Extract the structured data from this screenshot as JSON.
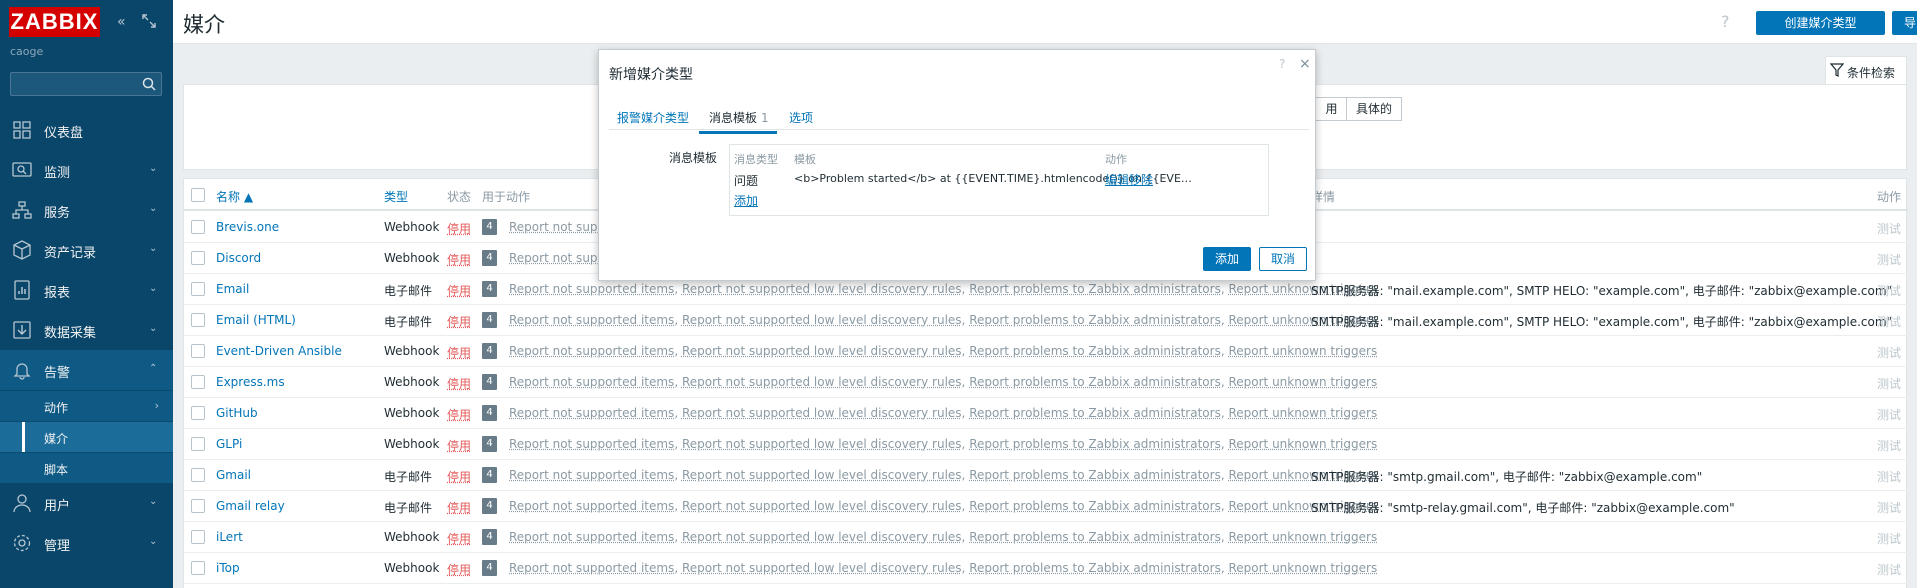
{
  "sidebar": {
    "logo": "ZABBIX",
    "server_name": "caoge",
    "search": {
      "value": "",
      "placeholder": ""
    },
    "menu": [
      {
        "label": "仪表盘",
        "icon": "dashboard-icon"
      },
      {
        "label": "监测",
        "icon": "monitoring-icon"
      },
      {
        "label": "服务",
        "icon": "services-icon"
      },
      {
        "label": "资产记录",
        "icon": "inventory-icon"
      },
      {
        "label": "报表",
        "icon": "reports-icon"
      },
      {
        "label": "数据采集",
        "icon": "data-collection-icon"
      },
      {
        "label": "告警",
        "icon": "bell-icon"
      },
      {
        "label": "用户",
        "icon": "users-icon"
      },
      {
        "label": "管理",
        "icon": "gear-icon"
      }
    ],
    "submenu": [
      {
        "label": "动作"
      },
      {
        "label": "媒介"
      },
      {
        "label": "脚本"
      }
    ]
  },
  "header": {
    "title": "媒介",
    "help": "?",
    "create_label": "创建媒介类型",
    "import_label": "导入"
  },
  "filter": {
    "tab_label": "条件检索",
    "seg_enabled": "用",
    "seg_specific": "具体的"
  },
  "table": {
    "headers": {
      "name": "名称 ▲",
      "type": "类型",
      "status": "状态",
      "used_in_actions": "用于动作",
      "details": "详情",
      "action": "动作"
    },
    "rows": [
      {
        "name": "Brevis.one",
        "type": "Webhook",
        "status": "停用",
        "count": "4",
        "actions": [
          "Report not supported items"
        ],
        "details": "",
        "test": "测试"
      },
      {
        "name": "Discord",
        "type": "Webhook",
        "status": "停用",
        "count": "4",
        "actions": [
          "Report not supported items"
        ],
        "details": "",
        "test": "测试"
      },
      {
        "name": "Email",
        "type": "电子邮件",
        "status": "停用",
        "count": "4",
        "actions": [
          "Report not supported items",
          "Report not supported low level discovery rules",
          "Report problems to Zabbix administrators",
          "Report unknown triggers"
        ],
        "details": "SMTP服务器: \"mail.example.com\", SMTP HELO: \"example.com\", 电子邮件: \"zabbix@example.com\"",
        "test": "测试"
      },
      {
        "name": "Email (HTML)",
        "type": "电子邮件",
        "status": "停用",
        "count": "4",
        "actions": [
          "Report not supported items",
          "Report not supported low level discovery rules",
          "Report problems to Zabbix administrators",
          "Report unknown triggers"
        ],
        "details": "SMTP服务器: \"mail.example.com\", SMTP HELO: \"example.com\", 电子邮件: \"zabbix@example.com\"",
        "test": "测试"
      },
      {
        "name": "Event-Driven Ansible",
        "type": "Webhook",
        "status": "停用",
        "count": "4",
        "actions": [
          "Report not supported items",
          "Report not supported low level discovery rules",
          "Report problems to Zabbix administrators",
          "Report unknown triggers"
        ],
        "details": "",
        "test": "测试"
      },
      {
        "name": "Express.ms",
        "type": "Webhook",
        "status": "停用",
        "count": "4",
        "actions": [
          "Report not supported items",
          "Report not supported low level discovery rules",
          "Report problems to Zabbix administrators",
          "Report unknown triggers"
        ],
        "details": "",
        "test": "测试"
      },
      {
        "name": "GitHub",
        "type": "Webhook",
        "status": "停用",
        "count": "4",
        "actions": [
          "Report not supported items",
          "Report not supported low level discovery rules",
          "Report problems to Zabbix administrators",
          "Report unknown triggers"
        ],
        "details": "",
        "test": "测试"
      },
      {
        "name": "GLPi",
        "type": "Webhook",
        "status": "停用",
        "count": "4",
        "actions": [
          "Report not supported items",
          "Report not supported low level discovery rules",
          "Report problems to Zabbix administrators",
          "Report unknown triggers"
        ],
        "details": "",
        "test": "测试"
      },
      {
        "name": "Gmail",
        "type": "电子邮件",
        "status": "停用",
        "count": "4",
        "actions": [
          "Report not supported items",
          "Report not supported low level discovery rules",
          "Report problems to Zabbix administrators",
          "Report unknown triggers"
        ],
        "details": "SMTP服务器: \"smtp.gmail.com\", 电子邮件: \"zabbix@example.com\"",
        "test": "测试"
      },
      {
        "name": "Gmail relay",
        "type": "电子邮件",
        "status": "停用",
        "count": "4",
        "actions": [
          "Report not supported items",
          "Report not supported low level discovery rules",
          "Report problems to Zabbix administrators",
          "Report unknown triggers"
        ],
        "details": "SMTP服务器: \"smtp-relay.gmail.com\", 电子邮件: \"zabbix@example.com\"",
        "test": "测试"
      },
      {
        "name": "iLert",
        "type": "Webhook",
        "status": "停用",
        "count": "4",
        "actions": [
          "Report not supported items",
          "Report not supported low level discovery rules",
          "Report problems to Zabbix administrators",
          "Report unknown triggers"
        ],
        "details": "",
        "test": "测试"
      },
      {
        "name": "iTop",
        "type": "Webhook",
        "status": "停用",
        "count": "4",
        "actions": [
          "Report not supported items",
          "Report not supported low level discovery rules",
          "Report problems to Zabbix administrators",
          "Report unknown triggers"
        ],
        "details": "",
        "test": "测试"
      }
    ]
  },
  "modal": {
    "title": "新增媒介类型",
    "help": "?",
    "close": "×",
    "tabs": [
      {
        "label": "报警媒介类型",
        "count": ""
      },
      {
        "label": "消息模板",
        "count": "1"
      },
      {
        "label": "选项",
        "count": ""
      }
    ],
    "field_label": "消息模板",
    "template_table": {
      "headers": {
        "message_type": "消息类型",
        "template": "模板",
        "action": "动作"
      },
      "row": {
        "message_type": "问题",
        "template": "<b>Problem started</b> at {{EVENT.TIME}.htmlencode()} on {{EVE…",
        "edit": "编辑",
        "remove": "移除"
      },
      "add": "添加"
    },
    "add_label": "添加",
    "cancel_label": "取消"
  },
  "colors": {
    "sidebar": "#0a466a",
    "accent": "#0275b8",
    "disabled": "#e45959",
    "logo": "#d40000"
  }
}
